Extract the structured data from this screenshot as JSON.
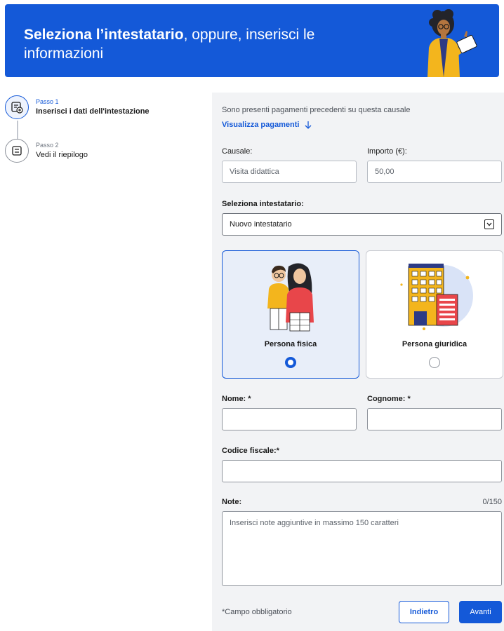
{
  "header": {
    "title_bold": "Seleziona l’intestatario",
    "title_rest": ", oppure, inserisci le informazioni",
    "background_color": "#1459d8"
  },
  "stepper": {
    "steps": [
      {
        "kicker": "Passo 1",
        "label": "Inserisci i dati dell'intestazione",
        "active": true,
        "icon": "checklist-add-icon"
      },
      {
        "kicker": "Passo 2",
        "label": "Vedi il riepilogo",
        "active": false,
        "icon": "checklist-icon"
      }
    ]
  },
  "form": {
    "info_text": "Sono presenti pagamenti precedenti su questa causale",
    "view_payments_link": "Visualizza pagamenti",
    "causale": {
      "label": "Causale:",
      "value": "Visita didattica"
    },
    "importo": {
      "label": "Importo (€):",
      "value": "50,00"
    },
    "holder_select": {
      "label": "Seleziona intestatario:",
      "value": "Nuovo intestatario"
    },
    "holder_type": {
      "options": [
        {
          "label": "Persona fisica",
          "selected": true
        },
        {
          "label": "Persona giuridica",
          "selected": false
        }
      ]
    },
    "nome": {
      "label": "Nome: *",
      "value": ""
    },
    "cognome": {
      "label": "Cognome: *",
      "value": ""
    },
    "codice_fiscale": {
      "label": "Codice fiscale:*",
      "value": ""
    },
    "note": {
      "label": "Note:",
      "counter": "0/150",
      "placeholder": "Inserisci note aggiuntive in massimo 150 caratteri"
    },
    "required_note": "*Campo obbligatorio",
    "back_button": "Indietro",
    "next_button": "Avanti"
  },
  "colors": {
    "accent": "#1459d8",
    "panel": "#f2f3f5",
    "selected_card": "#e8eef9"
  }
}
